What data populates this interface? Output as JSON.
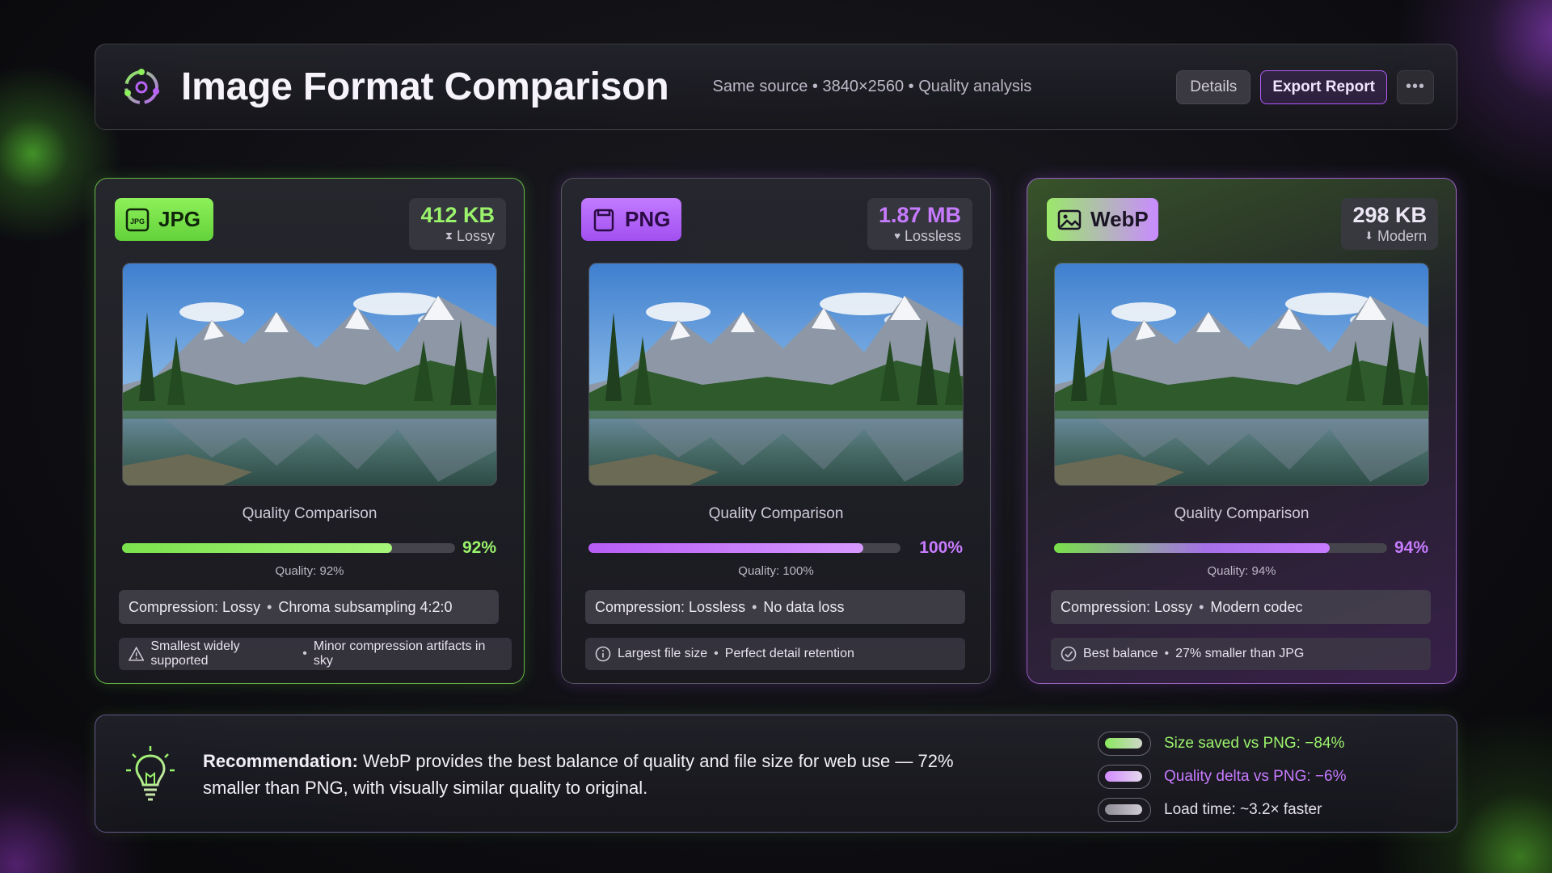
{
  "header": {
    "title": "Image Format Comparison",
    "subtitle": "Same source • 3840×2560 • Quality analysis",
    "details_label": "Details",
    "export_label": "Export Report",
    "more_label": "•••"
  },
  "cards": [
    {
      "format": "JPG",
      "size": "412 KB",
      "size_type": "Lossy",
      "quality_title": "Quality Comparison",
      "quality_percent": 92,
      "quality_percent_label": "92%",
      "quality_line": "Quality: 92%",
      "compression": "Compression: Lossy",
      "compression_detail": "Chroma subsampling 4:2:0",
      "note_main": "Smallest widely supported",
      "note_detail": "Minor compression artifacts in sky",
      "note_icon": "warning-icon",
      "accent": "#9AF36B"
    },
    {
      "format": "PNG",
      "size": "1.87 MB",
      "size_type": "Lossless",
      "quality_title": "Quality Comparison",
      "quality_percent": 100,
      "quality_percent_label": "100%",
      "quality_line": "Quality: 100%",
      "compression": "Compression: Lossless",
      "compression_detail": "No data loss",
      "note_main": "Largest file size",
      "note_detail": "Perfect detail retention",
      "note_icon": "info-icon",
      "accent": "#C77BFF"
    },
    {
      "format": "WebP",
      "size": "298 KB",
      "size_type": "Modern",
      "quality_title": "Quality Comparison",
      "quality_percent": 94,
      "quality_percent_label": "94%",
      "quality_line": "Quality: 94%",
      "compression": "Compression: Lossy",
      "compression_detail": "Modern codec",
      "note_main": "Best balance",
      "note_detail": "27% smaller than JPG",
      "note_icon": "check-circle-icon",
      "accent": "#C77BFF"
    }
  ],
  "recommendation": {
    "lead": "Recommendation:",
    "text": "WebP provides the best balance of quality and file size for web use — 72% smaller than PNG, with visually similar quality to original."
  },
  "stats": [
    {
      "label": "Size saved vs PNG: −84%",
      "color": "#9AF36B"
    },
    {
      "label": "Quality delta vs PNG: −6%",
      "color": "#C77BFF"
    },
    {
      "label": "Load time: ~3.2× faster",
      "color": "#E4E0EB"
    }
  ],
  "colors": {
    "green_accent": "#9AF36B",
    "purple_accent": "#C77BFF",
    "background": "#0d0d11"
  }
}
